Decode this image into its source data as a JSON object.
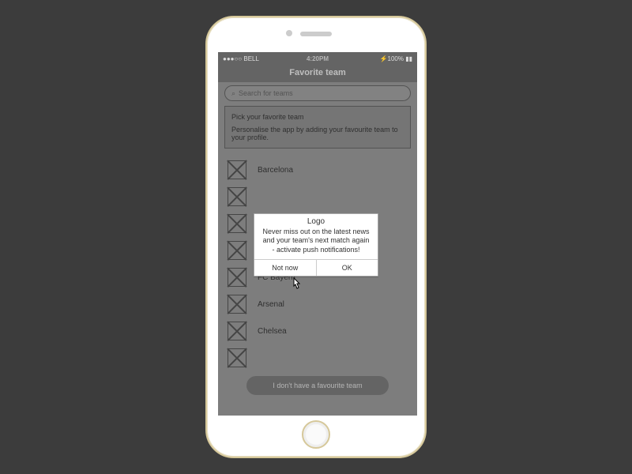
{
  "status_bar": {
    "carrier": "●●●○○ BELL",
    "wifi": "⋮",
    "time": "4:20PM",
    "battery": "⚡100% ▮▮"
  },
  "header": {
    "title": "Favorite team"
  },
  "search": {
    "placeholder": "Search for teams"
  },
  "info": {
    "title": "Pick your favorite team",
    "body": "Personalise the app by adding your favourite team to your profile."
  },
  "teams": [
    {
      "name": "Barcelona"
    },
    {
      "name": ""
    },
    {
      "name": ""
    },
    {
      "name": ""
    },
    {
      "name": "FC Bayern"
    },
    {
      "name": "Arsenal"
    },
    {
      "name": "Chelsea"
    },
    {
      "name": ""
    }
  ],
  "footer_button": "I don't have a favourite team",
  "modal": {
    "title": "Logo",
    "body": "Never miss out on the latest news and your team's next match again - activate push notifications!",
    "cancel": "Not now",
    "ok": "OK"
  }
}
